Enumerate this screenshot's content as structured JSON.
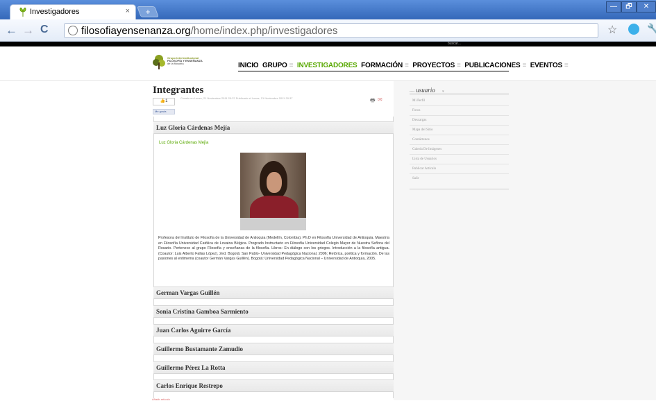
{
  "browser": {
    "tab_title": "Investigadores",
    "tab_close": "×",
    "new_tab": "+",
    "url_host": "filosofiayensenanza.org",
    "url_path": "/home/index.php/investigadores",
    "back": "←",
    "forward": "→",
    "reload": "C",
    "win_min": "—",
    "win_max": "🗗",
    "win_close": "✕"
  },
  "site": {
    "search_placeholder": "buscar...",
    "logo_line1": "Grupo Interinstitucional",
    "logo_line2": "FILOSOFÍA Y ENSEÑANZA",
    "logo_line3": "de la filosofía",
    "nav": [
      "INICIO",
      "GRUPO",
      "INVESTIGADORES",
      "FORMACIÓN",
      "PROYECTOS",
      "PUBLICACIONES",
      "EVENTOS"
    ],
    "nav_sep": "≡",
    "active_nav": "INVESTIGADORES"
  },
  "article": {
    "title": "Integrantes",
    "meta": "Creado en Lunes, 21 Noviembre 2011 20:37 Publicado el Lunes, 21 Noviembre 2011 20:37",
    "like_count": "1",
    "fb_like": "Me gusta",
    "first_person": "Luz Gloria Cárdenas Mejía",
    "detail_name": "Luz Gloria Cárdenas Mejía",
    "bio": "Profesora del Instituto de Filosofía de la Universidad de Antioquia (Medellín, Colombia). Ph.D en Filosofía Universidad de Antioquia. Maestría en Filosofía Universidad Católica de Lovaina Bélgica. Pregrado Instructario en Filosofía Universidad Colegio Mayor de Nuestra Señora del Rosario. Pertenece al grupo Filosofía y enseñanza de la filosofía. Libros: En diálogo con los griegos. Introducción a la filosofía antigua. (Coautor: Luis Alberto Fallas López), 2ed. Bogotá: San Pablo- Universidad Pedagógica Nacional, 2006; Retórica, poética y formación. De las pasiones al entimema (coautor Germán Vargas Guillén). Bogotá: Universidad Pedagógica Nacional – Universidad de Antioquia, 2005.",
    "other_people": [
      "German Vargas Guillén",
      "Sonia Cristina Gamboa Sarmiento",
      "Juan Carlos Aguirre García",
      "Guillermo Bustamante Zamudio",
      "Guillermo Pérez La Rotta",
      "Carlos Enrique Restrepo"
    ],
    "recommend": "Añadir artículo"
  },
  "sidebar": {
    "dots": "•••••",
    "title": "usuario",
    "chev": "▾",
    "items": [
      "Mi Perfil",
      "Foros",
      "Descargas",
      "Mapa del Sitio",
      "Contáctenos",
      "Galería De Imágenes",
      "Lista de Usuarios",
      "Publicar Artículo",
      "Salir"
    ]
  },
  "icons": {
    "print": "🖶",
    "email": "✉",
    "star": "☆",
    "wrench": "🔧"
  },
  "colors": {
    "accent_green": "#58a800",
    "chrome_blue": "#3468b9"
  }
}
